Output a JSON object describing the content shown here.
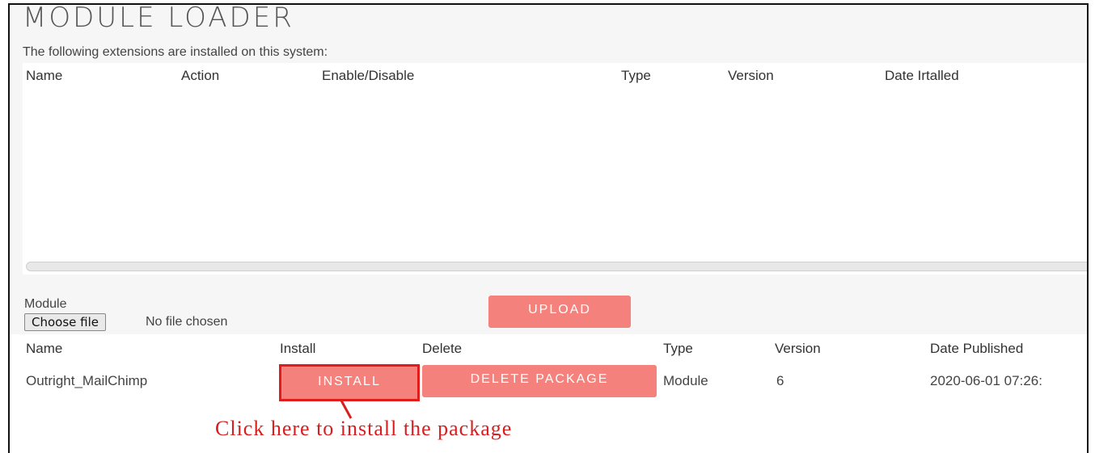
{
  "page": {
    "title": "MODULE LOADER",
    "intro": "The following extensions are installed on this system:"
  },
  "installed_table": {
    "columns": [
      "Name",
      "Action",
      "Enable/Disable",
      "Type",
      "Version",
      "Date Irtalled"
    ]
  },
  "upload": {
    "module_label": "Module",
    "choose_file_label": "Choose file",
    "no_file_text": "No file chosen",
    "upload_label": "UPLOAD"
  },
  "packages_table": {
    "columns": [
      "Name",
      "Install",
      "Delete",
      "Type",
      "Version",
      "Date Published"
    ],
    "rows": [
      {
        "name": "Outright_MailChimp",
        "install_label": "INSTALL",
        "delete_label": "DELETE PACKAGE",
        "type": "Module",
        "version": "6",
        "date_published": "2020-06-01 07:26:"
      }
    ]
  },
  "annotation": {
    "text": "Click here to install the package",
    "color": "#d81e1e"
  },
  "colors": {
    "button": "#f4817c",
    "highlight_border": "#e21b1b"
  }
}
